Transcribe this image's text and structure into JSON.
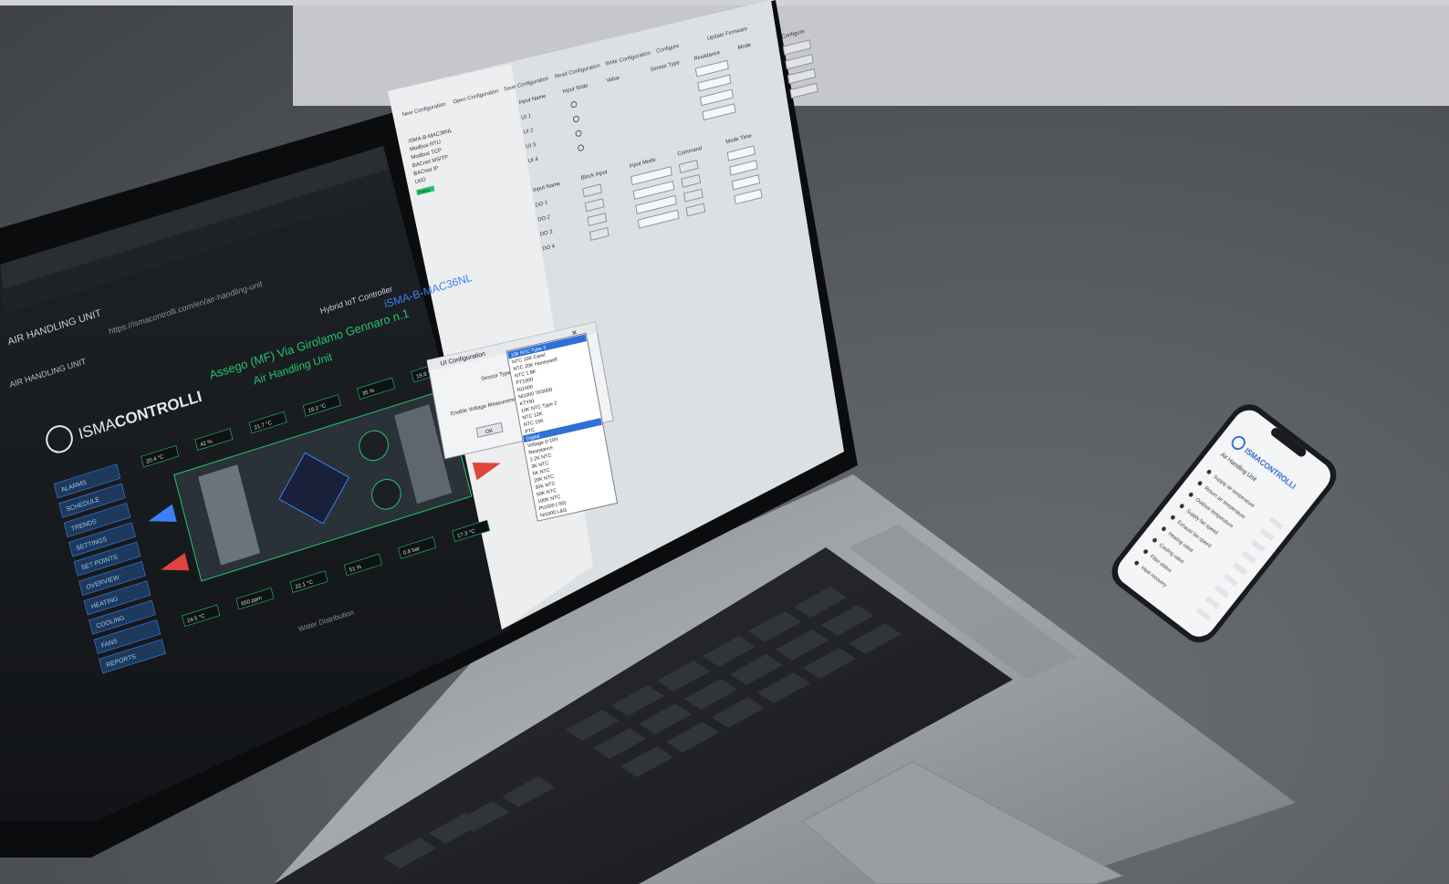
{
  "laptop": {
    "browser": {
      "tab_title": "AIR HANDLING UNIT",
      "address": "https://ismacontrolli.com/en/air-handling-unit",
      "page_header": "AIR HANDLING UNIT"
    },
    "dashboard": {
      "brand_prefix": "ISMA",
      "brand_suffix": "CONTROLLI",
      "controller_label": "Hybrid IoT Controller",
      "controller_model": "iSMA-B-MAC36NL",
      "title": "Assego (MF) Via Girolamo Gennaro n.1",
      "subtitle": "Air Handling Unit",
      "footer": "Water Distribution",
      "side_buttons": [
        "ALARMS",
        "SCHEDULE",
        "TRENDS",
        "SETTINGS",
        "SET POINTS",
        "OVERVIEW",
        "HEATING",
        "COOLING",
        "FANS",
        "REPORTS"
      ],
      "readings": [
        "20.4 °C",
        "42 %",
        "21.7 °C",
        "18.2 °C",
        "35 %",
        "19.8 °C",
        "24.5 °C",
        "650 ppm",
        "22.1 °C",
        "51 %",
        "0.8 bar",
        "17.3 °C"
      ]
    },
    "config_app": {
      "toolbar": [
        "New Configuration",
        "Open Configuration",
        "Save Configuration",
        "Read Configuration",
        "Write Configuration",
        "Configure",
        "Update Firmware"
      ],
      "tree": [
        "iSMA-B-MAC36NL",
        "Modbus RTU",
        "Modbus TCP",
        "BACnet MS/TP",
        "BACnet IP",
        "UI/O"
      ],
      "tree_status": "Online",
      "table_headers": [
        "Input Name",
        "Input State",
        "Value",
        "Sensor Type",
        "Resistance",
        "Mode",
        "Configure"
      ],
      "rows": [
        "UI 1",
        "UI 2",
        "UI 3",
        "UI 4"
      ],
      "do_headers": [
        "Input Name",
        "Block Input",
        "Input Mode",
        "Command",
        "Mode Time"
      ],
      "do_rows": [
        "DO 1",
        "DO 2",
        "DO 3",
        "DO 4"
      ]
    },
    "dialog": {
      "title": "UI Configuration",
      "sensor_label": "Sensor Type",
      "enable_label": "Enable Voltage Measurement",
      "ok_label": "OK",
      "options": [
        "10k NTC Type 3",
        "NTC 10K Carel",
        "NTC 20K Honeywell",
        "NTC 1.8K",
        "PT1000",
        "Ni1000",
        "Ni1000 TK5000",
        "KTY81",
        "10K NTC Type 2",
        "NTC 12K",
        "NTC 15K",
        "PTC",
        "Digital",
        "Voltage 0-10V",
        "Resistance",
        "2.2K NTC",
        "3K NTC",
        "5K NTC",
        "20K NTC",
        "30K NTC",
        "50K NTC",
        "100K NTC",
        "Pt1000 (-50)",
        "Ni1000 L&G"
      ]
    }
  },
  "phone": {
    "brand": "ISMACONTROLLI",
    "heading": "Air Handling Unit",
    "items": [
      "Supply air temperature",
      "Return air temperature",
      "Outdoor temperature",
      "Supply fan speed",
      "Exhaust fan speed",
      "Heating valve",
      "Cooling valve",
      "Filter status",
      "Heat recovery"
    ]
  },
  "colors": {
    "brand_green": "#25c46a",
    "accent_blue": "#3b82f6",
    "accent_red": "#e0443c",
    "selection_blue": "#2f6fd6"
  }
}
